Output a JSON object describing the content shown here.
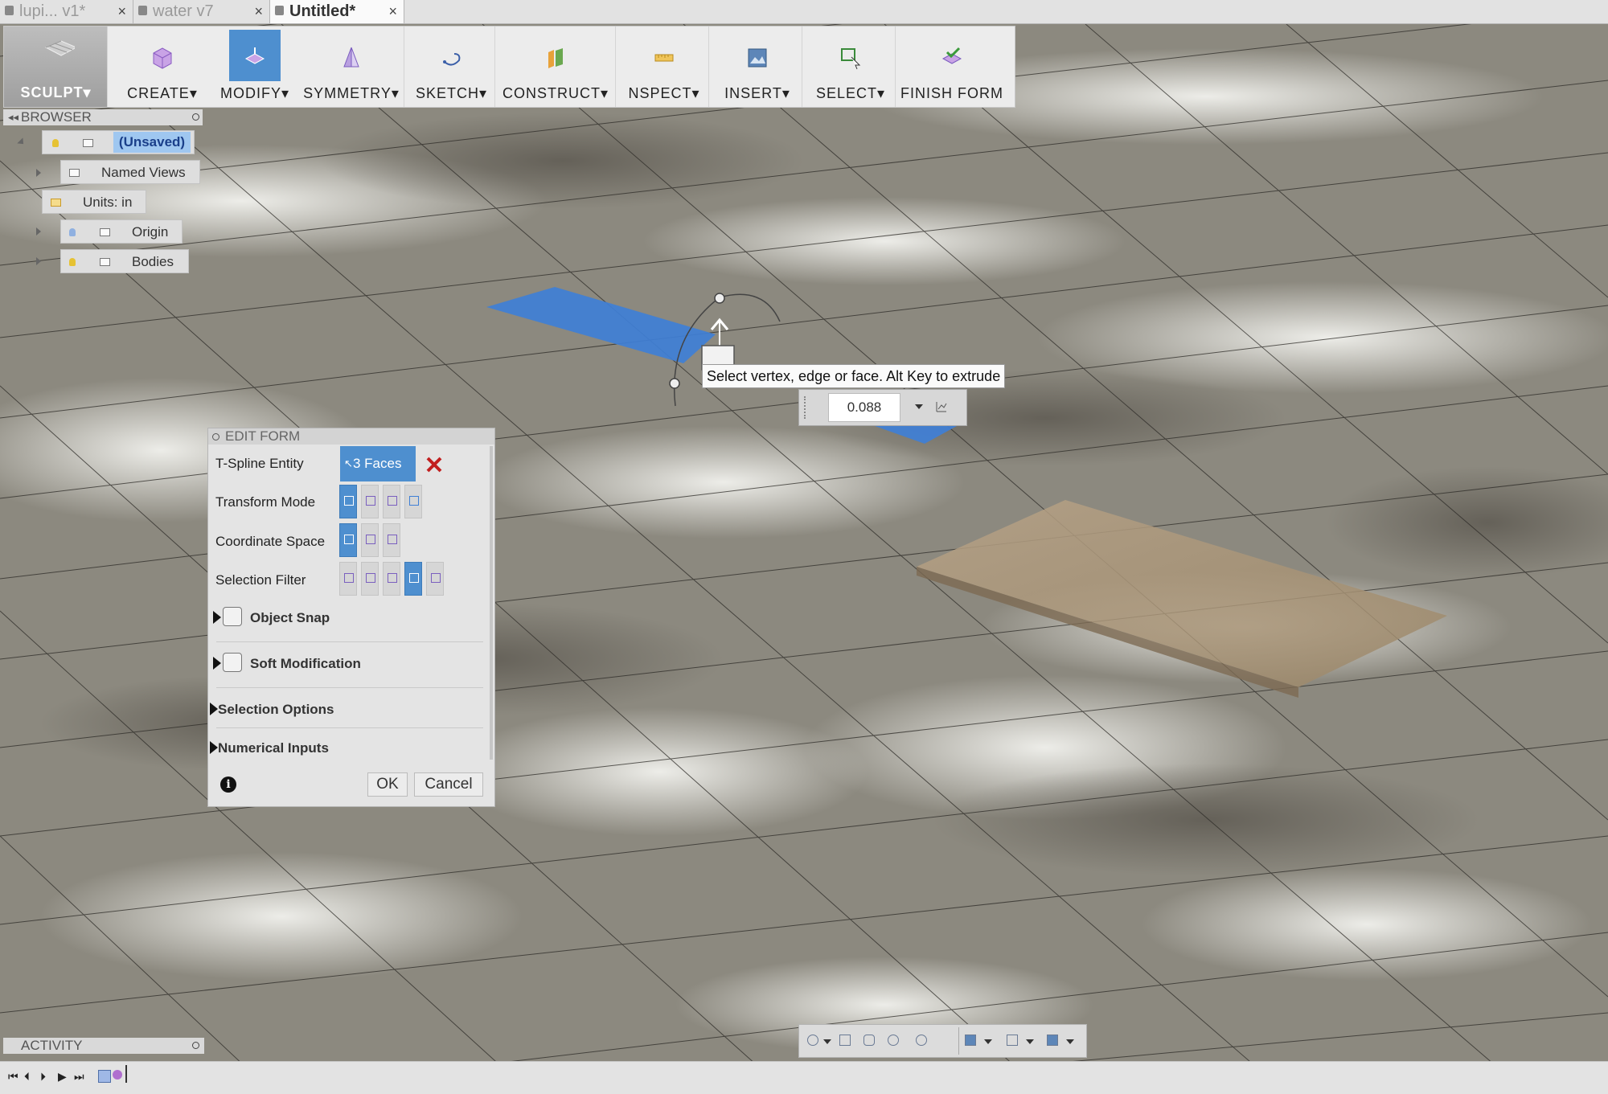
{
  "tabs": [
    {
      "title": "lupi... v1*",
      "close": "×"
    },
    {
      "title": "water v7",
      "close": "×"
    },
    {
      "title": "Untitled*",
      "close": "×"
    }
  ],
  "toolbar": {
    "workspace": "SCULPT",
    "items": [
      {
        "label": "CREATE",
        "icon": "box-icon"
      },
      {
        "label": "MODIFY",
        "icon": "modify-icon"
      },
      {
        "label": "SYMMETRY",
        "icon": "symmetry-icon"
      },
      {
        "label": "SKETCH",
        "icon": "sketch-icon"
      },
      {
        "label": "CONSTRUCT",
        "icon": "construct-icon"
      },
      {
        "label": "NSPECT",
        "icon": "inspect-icon"
      },
      {
        "label": "INSERT",
        "icon": "insert-icon"
      },
      {
        "label": "SELECT",
        "icon": "select-icon"
      },
      {
        "label": "FINISH FORM",
        "icon": "finish-form-icon"
      }
    ],
    "dropdown_marker": "▾"
  },
  "browser": {
    "title": "BROWSER",
    "root": "(Unsaved)",
    "items": [
      "Named Views",
      "Units: in",
      "Origin",
      "Bodies"
    ]
  },
  "edit_form": {
    "title": "EDIT FORM",
    "rows": {
      "entity_label": "T-Spline Entity",
      "entity_value": "3 Faces",
      "transform_label": "Transform Mode",
      "coordinate_label": "Coordinate Space",
      "filter_label": "Selection Filter"
    },
    "sections": {
      "object_snap": "Object Snap",
      "soft_mod": "Soft Modification",
      "selection_options": "Selection Options",
      "numerical_inputs": "Numerical Inputs"
    },
    "ok": "OK",
    "cancel": "Cancel"
  },
  "viewport": {
    "tooltip": "Select vertex, edge or face. Alt Key to extrude",
    "distance_value": "0.088",
    "selection_color": "#3f7fd6"
  },
  "activity": {
    "title": "ACTIVITY"
  },
  "colors": {
    "accent": "#4e8fcf",
    "toolbar_bg": "#ececec"
  }
}
